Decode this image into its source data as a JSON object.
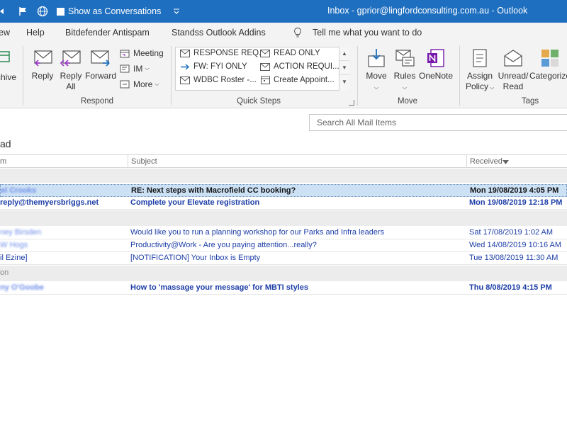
{
  "titlebar": {
    "toggle_label": "Show as Conversations",
    "title": "Inbox - gprior@lingfordconsulting.com.au  -  Outlook"
  },
  "menu": {
    "view": "ew",
    "help": "Help",
    "bitdefender": "Bitdefender Antispam",
    "standss": "Standss Outlook Addins",
    "tell_me": "Tell me what you want to do"
  },
  "ribbon": {
    "archive": "chive",
    "respond": {
      "reply": "Reply",
      "reply_all_1": "Reply",
      "reply_all_2": "All",
      "forward": "Forward",
      "meeting": "Meeting",
      "im": "IM",
      "more": "More",
      "group_label": "Respond"
    },
    "quick_steps": {
      "items": [
        "RESPONSE REQ...",
        "READ ONLY",
        "FW: FYI ONLY",
        "ACTION REQUI...",
        "WDBC Roster -...",
        "Create Appoint..."
      ],
      "group_label": "Quick Steps"
    },
    "move": {
      "move": "Move",
      "rules": "Rules",
      "onenote": "OneNote",
      "group_label": "Move"
    },
    "tags": {
      "assign_1": "Assign",
      "assign_2": "Policy",
      "unread_1": "Unread/",
      "unread_2": "Read",
      "categorize": "Categorize",
      "group_label": "Tags"
    }
  },
  "search": {
    "placeholder": "Search All Mail Items"
  },
  "folder": {
    "title": "ad"
  },
  "columns": {
    "from": "m",
    "subject": "Subject",
    "received": "Received"
  },
  "groups": {
    "g1": "",
    "g2": "",
    "g3": "",
    "g4": "on"
  },
  "mails": [
    {
      "from": "el Crooks",
      "subject": "RE: Next steps with Macrofield CC booking?",
      "received": "Mon 19/08/2019 4:05 PM"
    },
    {
      "from": "reply@themyersbriggs.net",
      "subject": "Complete your Elevate registration",
      "received": "Mon 19/08/2019 12:18 PM"
    },
    {
      "from": "ney Birsden",
      "subject": "Would like you to run a planning workshop for our Parks and Infra leaders",
      "received": "Sat 17/08/2019 1:02 AM"
    },
    {
      "from": "W Hogs",
      "subject": "Productivity@Work - Are you paying attention...really?",
      "received": "Wed 14/08/2019 10:16 AM"
    },
    {
      "from": "il Ezine]",
      "subject": "[NOTIFICATION] Your Inbox is Empty",
      "received": "Tue 13/08/2019 11:30 AM"
    },
    {
      "from": "ny O'Goobe",
      "subject": "How to 'massage your message' for MBTI styles",
      "received": "Thu 8/08/2019 4:15 PM"
    }
  ]
}
